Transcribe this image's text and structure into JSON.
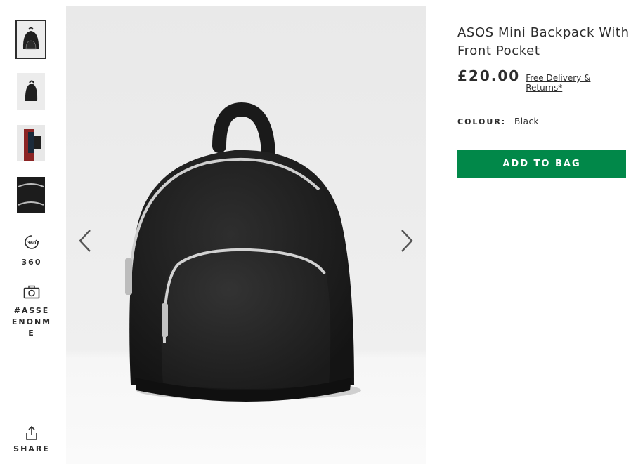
{
  "gallery": {
    "thumbnails": [
      {
        "alt": "Backpack front view",
        "icon": "backpack-front"
      },
      {
        "alt": "Backpack side view",
        "icon": "backpack-side"
      },
      {
        "alt": "Model wearing backpack",
        "icon": "model"
      },
      {
        "alt": "Backpack detail view",
        "icon": "backpack-detail"
      }
    ],
    "view_360_label": "360",
    "as_seen_on_me_label": "#ASSEENONME",
    "share_label": "SHARE"
  },
  "product": {
    "title": "ASOS Mini Backpack With Front Pocket",
    "price": "£20.00",
    "delivery_link": "Free Delivery & Returns*",
    "colour_label": "COLOUR:",
    "colour_value": "Black",
    "add_to_bag_label": "ADD TO BAG"
  },
  "colors": {
    "accent_green": "#018849",
    "text": "#2d2d2d",
    "image_background": "#ececec"
  }
}
